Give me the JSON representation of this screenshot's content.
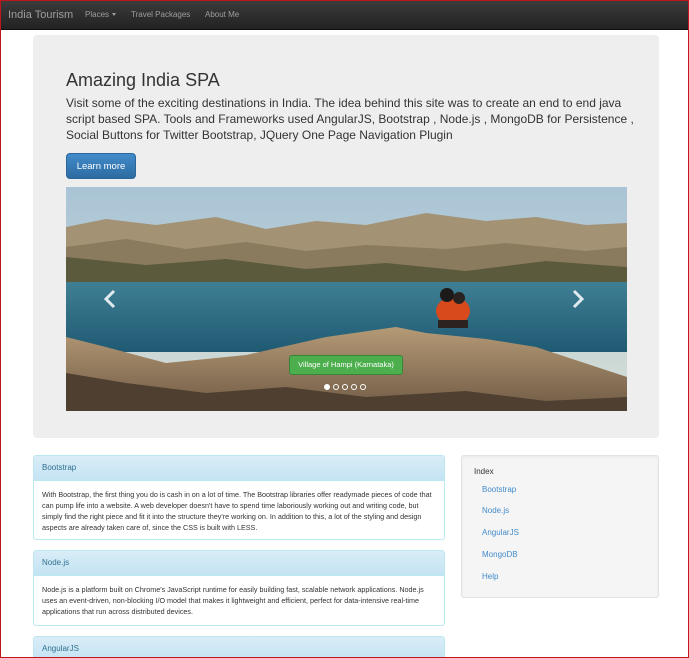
{
  "navbar": {
    "brand": "India Tourism",
    "items": [
      {
        "label": "Places",
        "dropdown": true
      },
      {
        "label": "Travel Packages",
        "dropdown": false
      },
      {
        "label": "About Me",
        "dropdown": false
      }
    ]
  },
  "jumbotron": {
    "title": "Amazing India SPA",
    "description": "Visit some of the exciting destinations in India. The idea behind this site was to create an end to end java script based SPA. Tools and Frameworks used AngularJS, Bootstrap , Node.js , MongoDB for Persistence , Social Buttons for Twitter Bootstrap, JQuery One Page Navigation Plugin",
    "button_label": "Learn more"
  },
  "carousel": {
    "caption": "Village of Hampi (Karnataka)",
    "slide_count": 5,
    "active_slide": 1,
    "prev_icon": "chevron-left-icon",
    "next_icon": "chevron-right-icon"
  },
  "panels": [
    {
      "heading": "Bootstrap",
      "body": "With Bootstrap, the first thing you do is cash in on a lot of time. The Bootstrap libraries offer readymade pieces of code that can pump life into a website. A web developer doesn't have to spend time laboriously working out and writing code, but simply find the right piece and fit it into the structure they're working on. In addition to this, a lot of the styling and design aspects are already taken care of, since the CSS is built with LESS."
    },
    {
      "heading": "Node.js",
      "body": "Node.js is a platform built on Chrome's JavaScript runtime for easily building fast, scalable network applications. Node.js uses an event-driven, non-blocking I/O model that makes it lightweight and efficient, perfect for data-intensive real-time applications that run across distributed devices."
    },
    {
      "heading": "AngularJS",
      "body": ""
    }
  ],
  "index": {
    "title": "Index",
    "links": [
      "Bootstrap",
      "Node.js",
      "AngularJS",
      "MongoDB",
      "Help"
    ]
  },
  "colors": {
    "navbar": "#222222",
    "primary": "#428bca",
    "caption_green": "#4cae4c",
    "panel_border": "#bce8f1",
    "window_border": "#c0161b"
  }
}
